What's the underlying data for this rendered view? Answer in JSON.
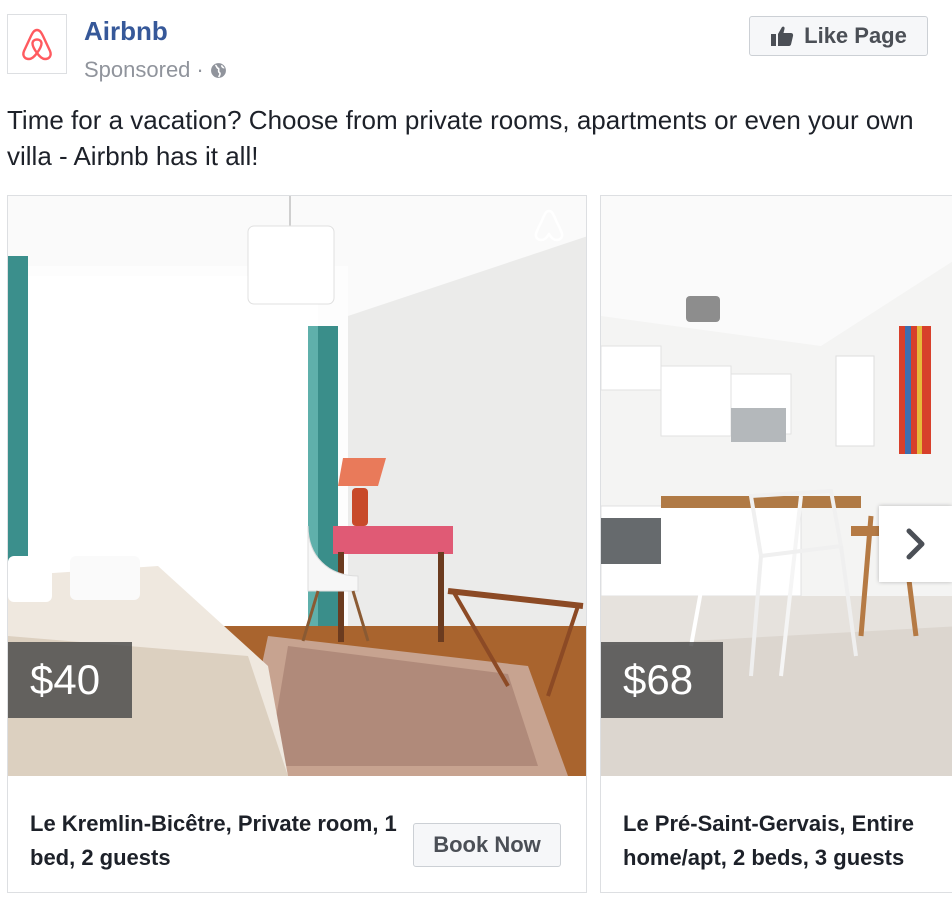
{
  "header": {
    "page_name": "Airbnb",
    "sponsored": "Sponsored",
    "separator": "·",
    "like_button": "Like Page"
  },
  "post": {
    "text": "Time for a vacation? Choose from private rooms, apartments or even your own villa - Airbnb has it all!"
  },
  "carousel": {
    "cards": [
      {
        "price": "$40",
        "title": "Le Kremlin-Bicêtre, Private room, 1 bed, 2 guests",
        "button": "Book Now"
      },
      {
        "price": "$68",
        "title": "Le Pré-Saint-Gervais, Entire home/apt, 2 beds, 3 guests"
      }
    ]
  },
  "colors": {
    "brand_link": "#365899",
    "airbnb_red": "#ff5a5f",
    "meta_gray": "#90949c"
  },
  "icons": {
    "logo": "airbnb-logo-icon",
    "globe": "globe-icon",
    "like": "thumbs-up-icon",
    "next": "chevron-right-icon"
  }
}
